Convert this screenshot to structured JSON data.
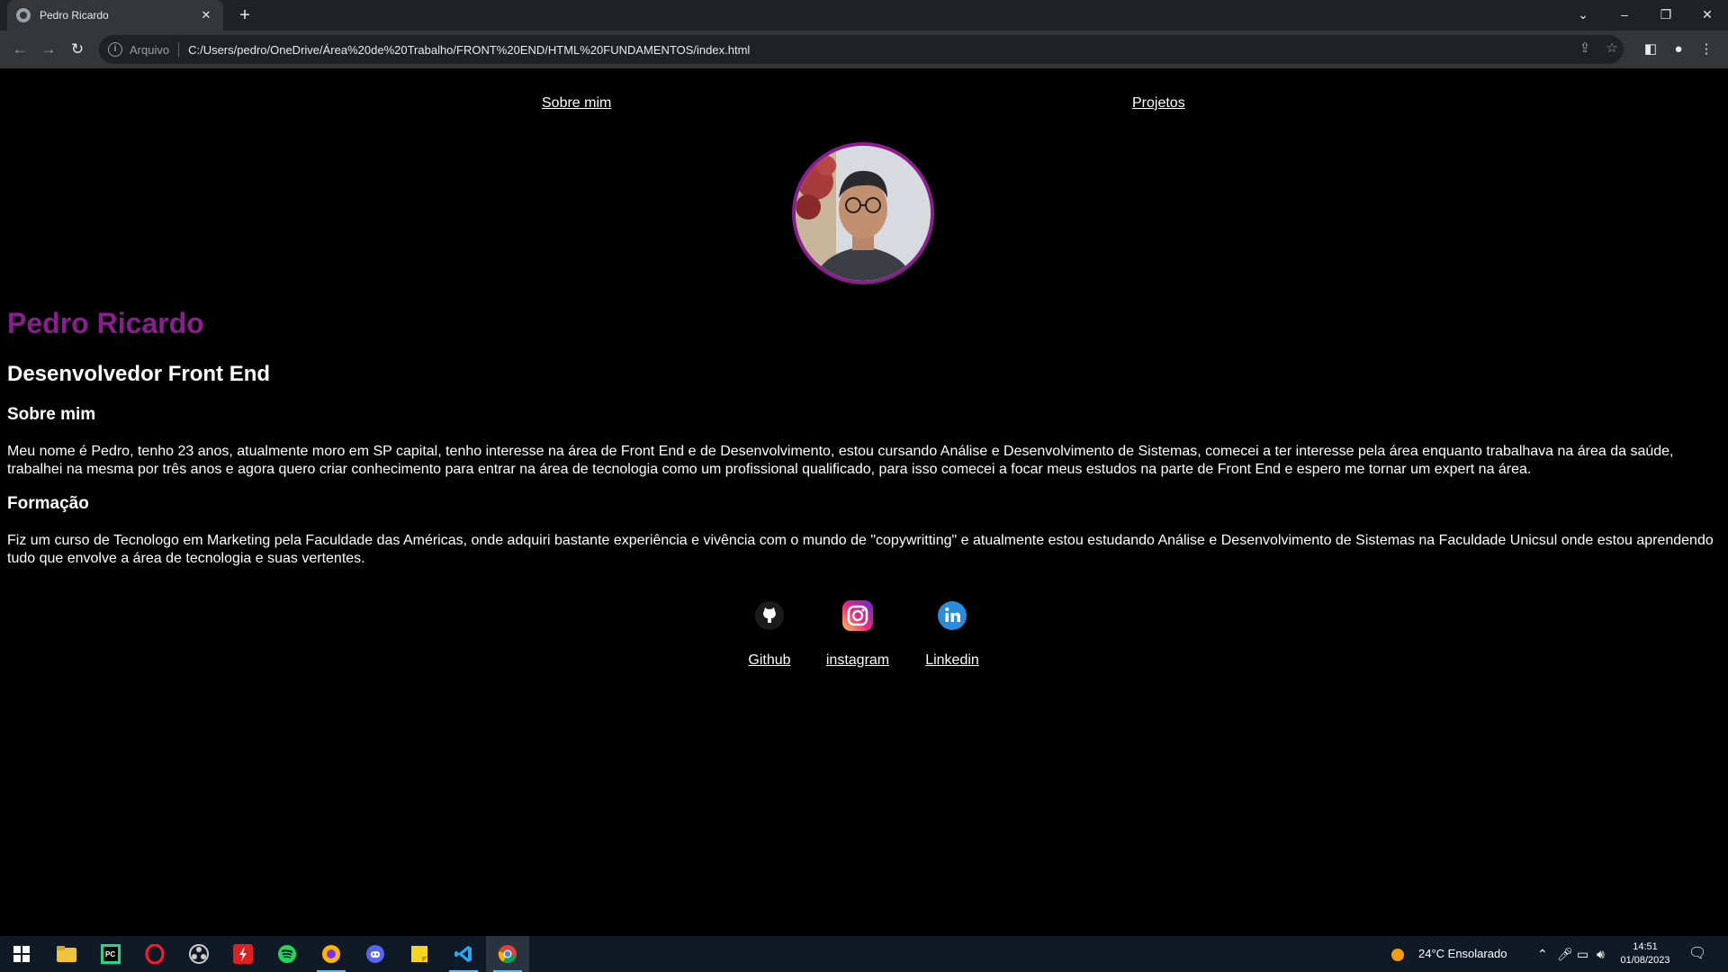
{
  "browser": {
    "tab_title": "Pedro Ricardo",
    "tab_close": "✕",
    "new_tab": "+",
    "omnibox_label": "Arquivo",
    "url": "C:/Users/pedro/OneDrive/Área%20de%20Trabalho/FRONT%20END/HTML%20FUNDAMENTOS/index.html",
    "window_controls": [
      "⌄",
      "–",
      "❐",
      "✕"
    ]
  },
  "nav": {
    "about": "Sobre mim",
    "projects": "Projetos"
  },
  "profile": {
    "name": "Pedro Ricardo",
    "role": "Desenvolvedor Front End"
  },
  "sections": {
    "about_title": "Sobre mim",
    "about_text": "Meu nome é Pedro, tenho 23 anos, atualmente moro em SP capital, tenho interesse na área de Front End e de Desenvolvimento, estou cursando Análise e Desenvolvimento de Sistemas, comecei a ter interesse pela área enquanto trabalhava na área da saúde, trabalhei na mesma por três anos e agora quero criar conhecimento para entrar na área de tecnologia como um profissional qualificado, para isso comecei a focar meus estudos na parte de Front End e espero me tornar um expert na área.",
    "education_title": "Formação",
    "education_text": "Fiz um curso de Tecnologo em Marketing pela Faculdade das Américas, onde adquiri bastante experiência e vivência com o mundo de \"copywritting\" e atualmente estou estudando Análise e Desenvolvimento de Sistemas na Faculdade Unicsul onde estou aprendendo tudo que envolve a área de tecnologia e suas vertentes."
  },
  "social": [
    {
      "label": "Github",
      "icon": "github-icon"
    },
    {
      "label": "instagram",
      "icon": "instagram-icon"
    },
    {
      "label": "Linkedin",
      "icon": "linkedin-icon"
    }
  ],
  "taskbar": {
    "apps": [
      "windows-start",
      "file-explorer",
      "pycharm",
      "opera",
      "obs",
      "flash",
      "spotify",
      "brave",
      "discord",
      "sticky-notes",
      "vscode",
      "chrome"
    ],
    "weather": "24°C  Ensolarado",
    "time": "14:51",
    "date": "01/08/2023"
  },
  "colors": {
    "accent": "#8b1d8f",
    "background": "#000000",
    "chrome_dark": "#202124",
    "chrome": "#35363a"
  }
}
